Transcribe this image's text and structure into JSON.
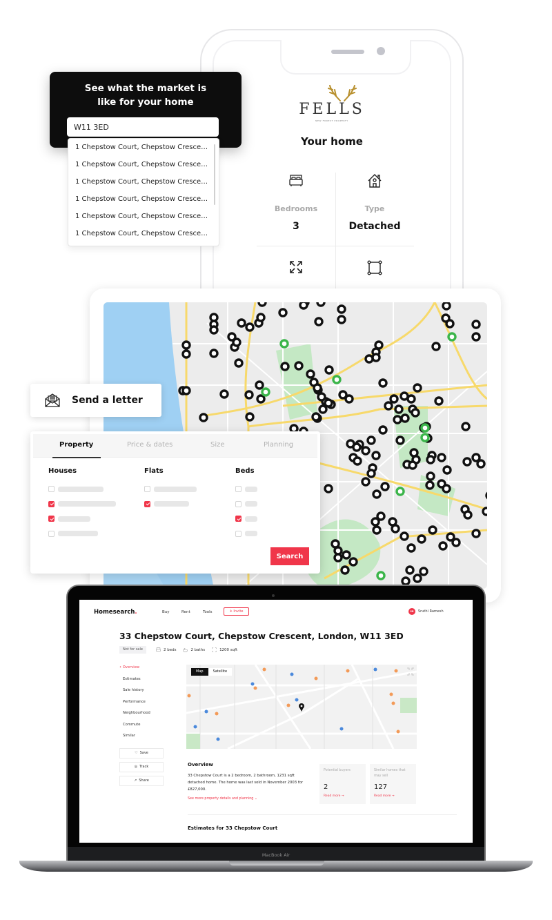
{
  "phone": {
    "brand": "FELLS",
    "brand_tagline": "NEW FOREST PROPERTY",
    "title": "Your home",
    "stats": [
      {
        "icon": "bed-icon",
        "label": "Bedrooms",
        "value": "3"
      },
      {
        "icon": "house-icon",
        "label": "Type",
        "value": "Detached"
      },
      {
        "icon": "expand-icon",
        "label": "",
        "value": ""
      },
      {
        "icon": "area-icon",
        "label": "",
        "value": ""
      }
    ]
  },
  "search_popup": {
    "title_line1": "See what the market is",
    "title_line2": "like for your home",
    "input_value": "W11 3ED",
    "suggestions": [
      "1 Chepstow Court, Chepstow Crescent ...",
      "1 Chepstow Court, Chepstow Crescent ...",
      "1 Chepstow Court, Chepstow Crescent ...",
      "1 Chepstow Court, Chepstow Crescent ...",
      "1 Chepstow Court, Chepstow Crescent ...",
      "1 Chepstow Court, Chepstow Crescent ..."
    ]
  },
  "letter_card": {
    "label": "Send a letter",
    "icon": "envelope-icon"
  },
  "filter_panel": {
    "tabs": [
      {
        "label": "Property",
        "active": true
      },
      {
        "label": "Price & dates",
        "active": false
      },
      {
        "label": "Size",
        "active": false
      },
      {
        "label": "Planning",
        "active": false
      }
    ],
    "columns": [
      {
        "title": "Houses",
        "options": [
          false,
          true,
          true,
          false
        ]
      },
      {
        "title": "Flats",
        "options": [
          false,
          true
        ]
      },
      {
        "title": "Beds",
        "options": [
          false,
          false,
          true,
          false
        ]
      }
    ],
    "search_label": "Search"
  },
  "map_markers": {
    "colors": {
      "sold": "#111111",
      "highlight": "#3bb54a"
    }
  },
  "laptop": {
    "model_label": "MacBook Air",
    "app": {
      "logo": "Homesearch",
      "nav": [
        "Buy",
        "Rent",
        "Tools"
      ],
      "invite_label": "Invite",
      "user_initials": "SR",
      "user_name": "Sruthi Ramesh",
      "property_title": "33 Chepstow Court, Chepstow Crescent, London, W11 3ED",
      "status_badge": "Not for sale",
      "beds": "2 beds",
      "baths": "2 baths",
      "area": "1200 sqft",
      "sidebar": [
        "Overview",
        "Estimates",
        "Sale history",
        "Performance",
        "Neighbourhood",
        "Commute",
        "Similar"
      ],
      "actions": [
        "Save",
        "Track",
        "Share"
      ],
      "map_toggle": [
        "Map",
        "Satellite"
      ],
      "overview_title": "Overview",
      "overview_text": "33 Chepstow Court is a 2 bedroom, 2 bathroom, 1231 sqft detached home. The home was last sold in November 2003 for £827,000.",
      "see_more": "See more property details and planning",
      "kpis": [
        {
          "label": "Potential buyers",
          "value": "2",
          "link": "Read more"
        },
        {
          "label": "Similar homes that may sell",
          "value": "127",
          "link": "Read more"
        }
      ],
      "estimates_title": "Estimates for 33 Chepstow Court"
    }
  },
  "accent_color": "#f0364a"
}
